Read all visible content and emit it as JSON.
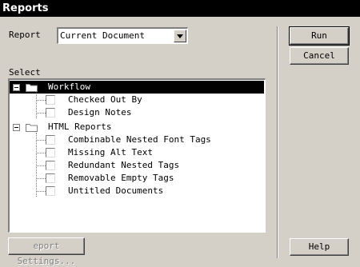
{
  "title": "Reports",
  "report_label": "Report",
  "report_value": "Current Document",
  "select_label": "Select",
  "tree": {
    "group1": "Workflow",
    "items1": [
      "Checked Out By",
      "Design Notes"
    ],
    "group2": "HTML Reports",
    "items2": [
      "Combinable Nested Font Tags",
      "Missing Alt Text",
      "Redundant Nested Tags",
      "Removable Empty Tags",
      "Untitled Documents"
    ]
  },
  "buttons": {
    "run": "Run",
    "cancel": "Cancel",
    "help": "Help",
    "report_settings": "eport Settings..."
  }
}
